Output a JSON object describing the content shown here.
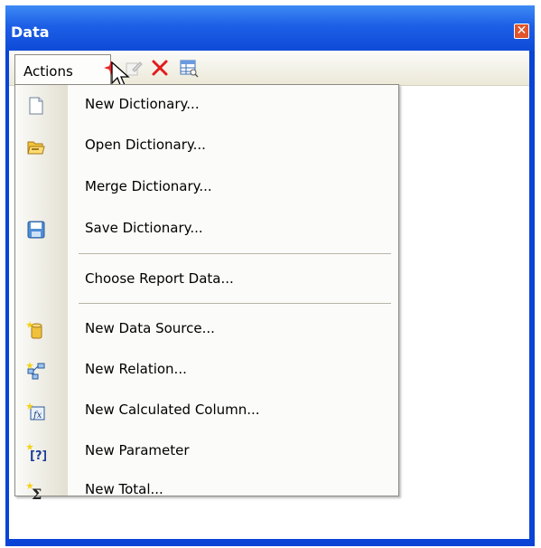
{
  "window": {
    "title": "Data"
  },
  "toolbar": {
    "actions_label": "Actions"
  },
  "menu": {
    "items": [
      {
        "label": "New Dictionary...",
        "icon": "new-document-icon"
      },
      {
        "label": "Open Dictionary...",
        "icon": "open-folder-icon"
      },
      {
        "label": "Merge Dictionary...",
        "icon": ""
      },
      {
        "label": "Save Dictionary...",
        "icon": "save-disk-icon"
      },
      {
        "label": "Choose Report Data...",
        "icon": ""
      },
      {
        "label": "New Data Source...",
        "icon": "data-source-icon"
      },
      {
        "label": "New Relation...",
        "icon": "relation-icon"
      },
      {
        "label": "New Calculated Column...",
        "icon": "calculated-column-icon"
      },
      {
        "label": "New Parameter",
        "icon": "parameter-icon"
      },
      {
        "label": "New Total...",
        "icon": "total-sum-icon"
      }
    ]
  },
  "colors": {
    "title_bar": "#0e4bd8",
    "menu_bg": "#fbfbf9",
    "close_button": "#e2542c",
    "delete_x": "#e21b1b"
  }
}
